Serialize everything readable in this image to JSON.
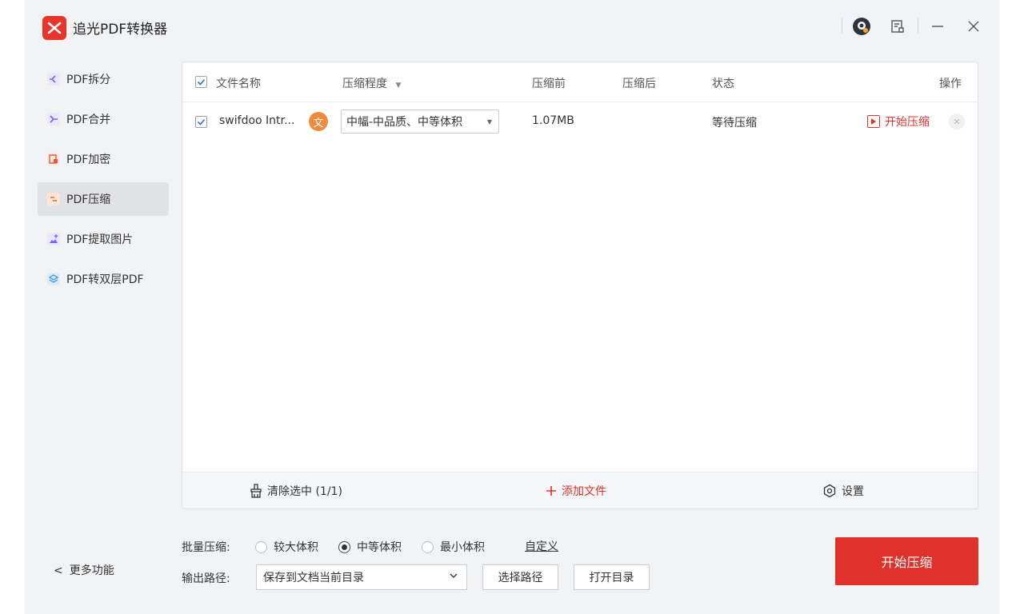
{
  "app": {
    "title": "追光PDF转换器"
  },
  "titlebar": {
    "icons": [
      "avatar-icon",
      "feedback-icon",
      "minimize-icon",
      "close-icon"
    ]
  },
  "sidebar": {
    "items": [
      {
        "label": "PDF拆分",
        "icon": "split-icon",
        "color": "#7b5cf0"
      },
      {
        "label": "PDF合并",
        "icon": "merge-icon",
        "color": "#7b5cf0"
      },
      {
        "label": "PDF加密",
        "icon": "lock-file-icon",
        "color": "#e8593a"
      },
      {
        "label": "PDF压缩",
        "icon": "compress-icon",
        "color": "#f07a3a",
        "active": true
      },
      {
        "label": "PDF提取图片",
        "icon": "extract-image-icon",
        "color": "#7b5cf0"
      },
      {
        "label": "PDF转双层PDF",
        "icon": "layers-icon",
        "color": "#3a8fe0"
      }
    ],
    "more": "更多功能"
  },
  "table": {
    "headers": {
      "filename": "文件名称",
      "level": "压缩程度",
      "before": "压缩前",
      "after": "压缩后",
      "status": "状态",
      "action": "操作"
    },
    "rows": [
      {
        "filename": "swifdoo Intr...",
        "lang_badge": "文",
        "level": "中幅-中品质、中等体积",
        "before": "1.07MB",
        "after": "",
        "status": "等待压缩",
        "action": "开始压缩",
        "checked": true
      }
    ]
  },
  "footer": {
    "clear": "清除选中 (1/1)",
    "add": "添加文件",
    "settings": "设置"
  },
  "batch": {
    "label": "批量压缩:",
    "options": [
      "较大体积",
      "中等体积",
      "最小体积"
    ],
    "selected": "中等体积",
    "custom": "自定义"
  },
  "output": {
    "label": "输出路径:",
    "value": "保存到文档当前目录",
    "choose": "选择路径",
    "open": "打开目录"
  },
  "start_button": "开始压缩",
  "colors": {
    "accent": "#e0312a",
    "badge": "#f08a3c"
  }
}
